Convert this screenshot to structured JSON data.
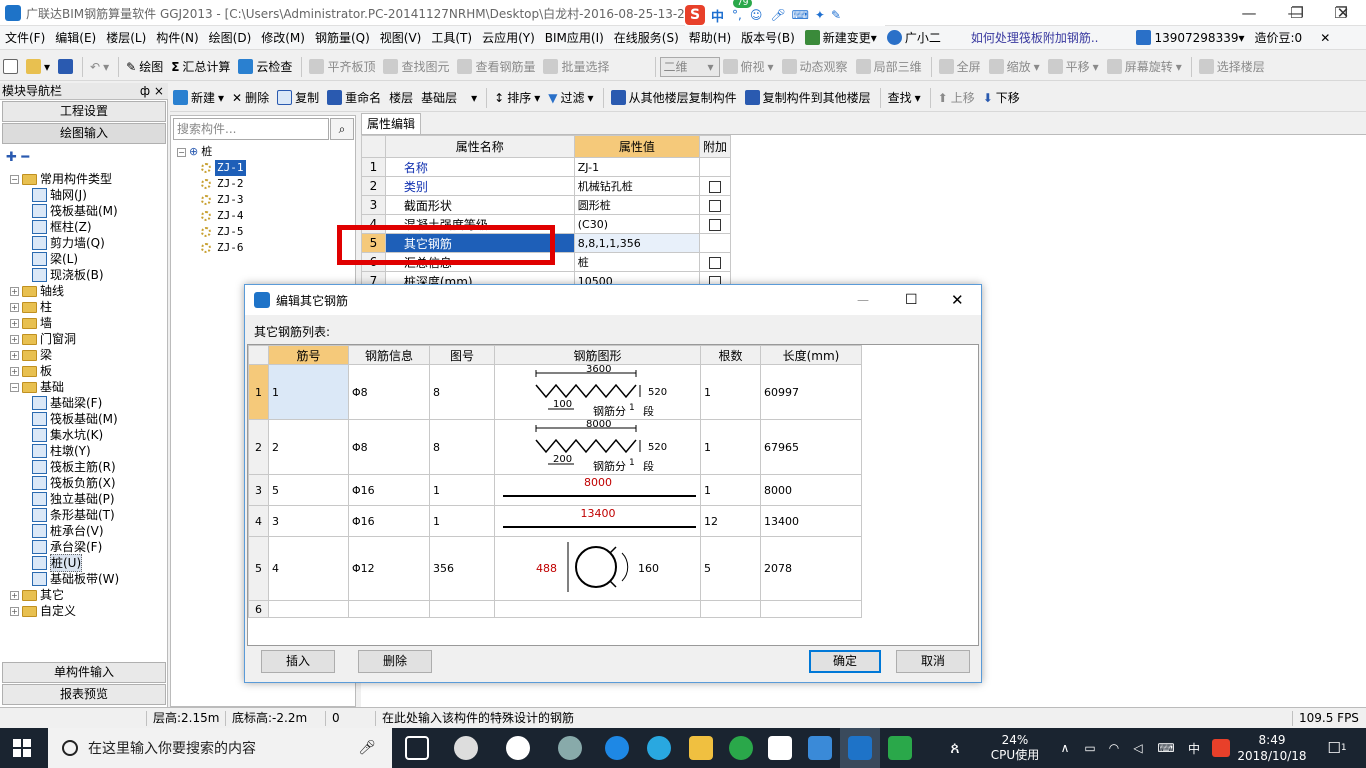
{
  "app": {
    "title": "广联达BIM钢筋算量软件 GGJ2013 - [C:\\Users\\Administrator.PC-20141127NRHM\\Desktop\\白龙村-2016-08-25-13-27",
    "ime_badge": "79",
    "ime_lang": "中"
  },
  "menubar": {
    "items": [
      "文件(F)",
      "编辑(E)",
      "楼层(L)",
      "构件(N)",
      "绘图(D)",
      "修改(M)",
      "钢筋量(Q)",
      "视图(V)",
      "工具(T)",
      "云应用(Y)",
      "BIM应用(I)",
      "在线服务(S)",
      "帮助(H)",
      "版本号(B)",
      "新建变更",
      "广小二"
    ],
    "question_link": "如何处理筏板附加钢筋..",
    "phone": "13907298339",
    "beans": "造价豆:0"
  },
  "toolbar1": {
    "items": [
      "绘图",
      "汇总计算",
      "云检查",
      "平齐板顶",
      "查找图元",
      "查看钢筋量",
      "批量选择"
    ],
    "view_mode": "二维",
    "view_items": [
      "俯视",
      "动态观察",
      "局部三维",
      "全屏",
      "缩放",
      "平移",
      "屏幕旋转",
      "选择楼层"
    ]
  },
  "toolbar2": {
    "items": [
      "新建",
      "删除",
      "复制",
      "重命名",
      "楼层"
    ],
    "floor_value": "基础层",
    "items2": [
      "排序",
      "过滤",
      "从其他楼层复制构件",
      "复制构件到其他楼层",
      "查找",
      "上移",
      "下移"
    ]
  },
  "nav": {
    "header": "模块导航栏",
    "pin": "ф ×",
    "btn_project": "工程设置",
    "btn_draw": "绘图输入",
    "btn_single": "单构件输入",
    "btn_report": "报表预览",
    "tree": [
      {
        "label": "常用构件类型",
        "level": 0,
        "type": "folder",
        "exp": "−"
      },
      {
        "label": "轴网(J)",
        "level": 1,
        "type": "comp"
      },
      {
        "label": "筏板基础(M)",
        "level": 1,
        "type": "comp"
      },
      {
        "label": "框柱(Z)",
        "level": 1,
        "type": "comp"
      },
      {
        "label": "剪力墙(Q)",
        "level": 1,
        "type": "comp"
      },
      {
        "label": "梁(L)",
        "level": 1,
        "type": "comp"
      },
      {
        "label": "现浇板(B)",
        "level": 1,
        "type": "comp"
      },
      {
        "label": "轴线",
        "level": 0,
        "type": "folder",
        "exp": "+"
      },
      {
        "label": "柱",
        "level": 0,
        "type": "folder",
        "exp": "+"
      },
      {
        "label": "墙",
        "level": 0,
        "type": "folder",
        "exp": "+"
      },
      {
        "label": "门窗洞",
        "level": 0,
        "type": "folder",
        "exp": "+"
      },
      {
        "label": "梁",
        "level": 0,
        "type": "folder",
        "exp": "+"
      },
      {
        "label": "板",
        "level": 0,
        "type": "folder",
        "exp": "+"
      },
      {
        "label": "基础",
        "level": 0,
        "type": "folder",
        "exp": "−"
      },
      {
        "label": "基础梁(F)",
        "level": 1,
        "type": "comp"
      },
      {
        "label": "筏板基础(M)",
        "level": 1,
        "type": "comp"
      },
      {
        "label": "集水坑(K)",
        "level": 1,
        "type": "comp"
      },
      {
        "label": "柱墩(Y)",
        "level": 1,
        "type": "comp"
      },
      {
        "label": "筏板主筋(R)",
        "level": 1,
        "type": "comp"
      },
      {
        "label": "筏板负筋(X)",
        "level": 1,
        "type": "comp"
      },
      {
        "label": "独立基础(P)",
        "level": 1,
        "type": "comp"
      },
      {
        "label": "条形基础(T)",
        "level": 1,
        "type": "comp"
      },
      {
        "label": "桩承台(V)",
        "level": 1,
        "type": "comp"
      },
      {
        "label": "承台梁(F)",
        "level": 1,
        "type": "comp"
      },
      {
        "label": "桩(U)",
        "level": 1,
        "type": "comp",
        "selected": true
      },
      {
        "label": "基础板带(W)",
        "level": 1,
        "type": "comp"
      },
      {
        "label": "其它",
        "level": 0,
        "type": "folder",
        "exp": "+"
      },
      {
        "label": "自定义",
        "level": 0,
        "type": "folder",
        "exp": "+"
      }
    ]
  },
  "components": {
    "search_placeholder": "搜索构件...",
    "root": "桩",
    "items": [
      "ZJ-1",
      "ZJ-2",
      "ZJ-3",
      "ZJ-4",
      "ZJ-5",
      "ZJ-6"
    ],
    "selected": "ZJ-1"
  },
  "props": {
    "tab": "属性编辑",
    "headers": [
      "属性名称",
      "属性值",
      "附加"
    ],
    "rows": [
      {
        "n": "1",
        "name": "名称",
        "value": "ZJ-1",
        "blue": true,
        "cb": false
      },
      {
        "n": "2",
        "name": "类别",
        "value": "机械钻孔桩",
        "blue": true,
        "cb": true
      },
      {
        "n": "3",
        "name": "截面形状",
        "value": "圆形桩",
        "blue": false,
        "cb": true
      },
      {
        "n": "4",
        "name": "混凝土强度等级",
        "value": "(C30)",
        "blue": false,
        "cb": true
      },
      {
        "n": "5",
        "name": "其它钢筋",
        "value": "8,8,1,1,356",
        "blue": false,
        "cb": false,
        "selected": true
      },
      {
        "n": "6",
        "name": "汇总信息",
        "value": "桩",
        "blue": false,
        "cb": true
      },
      {
        "n": "7",
        "name": "桩深度(mm)",
        "value": "10500",
        "blue": false,
        "cb": true
      }
    ]
  },
  "dialog": {
    "title": "编辑其它钢筋",
    "list_label": "其它钢筋列表:",
    "headers": [
      "筋号",
      "钢筋信息",
      "图号",
      "钢筋图形",
      "根数",
      "长度(mm)"
    ],
    "rows": [
      {
        "n": "1",
        "bar": "1",
        "info": "Φ8",
        "fig": "8",
        "count": "1",
        "length": "60997",
        "shape": "zigzag",
        "top": "3600",
        "bottom": "100",
        "side": "520",
        "note_a": "钢筋分",
        "note_b": "1",
        "note_c": "段"
      },
      {
        "n": "2",
        "bar": "2",
        "info": "Φ8",
        "fig": "8",
        "count": "1",
        "length": "67965",
        "shape": "zigzag",
        "top": "8000",
        "bottom": "200",
        "side": "520",
        "note_a": "钢筋分",
        "note_b": "1",
        "note_c": "段"
      },
      {
        "n": "3",
        "bar": "5",
        "info": "Φ16",
        "fig": "1",
        "count": "1",
        "length": "8000",
        "shape": "line",
        "dim": "8000"
      },
      {
        "n": "4",
        "bar": "3",
        "info": "Φ16",
        "fig": "1",
        "count": "12",
        "length": "13400",
        "shape": "line",
        "dim": "13400"
      },
      {
        "n": "5",
        "bar": "4",
        "info": "Φ12",
        "fig": "356",
        "count": "5",
        "length": "2078",
        "shape": "ring",
        "dia": "488",
        "hook": "160"
      },
      {
        "n": "6",
        "bar": "",
        "info": "",
        "fig": "",
        "count": "",
        "length": "",
        "shape": "none"
      }
    ],
    "btn_insert": "插入",
    "btn_delete": "删除",
    "btn_ok": "确定",
    "btn_cancel": "取消"
  },
  "status": {
    "floor_height": "层高:2.15m",
    "bottom_height": "底标高:-2.2m",
    "zero": "0",
    "hint": "在此处输入该构件的特殊设计的钢筋",
    "fps": "109.5 FPS"
  },
  "taskbar": {
    "search_placeholder": "在这里输入你要搜索的内容",
    "cpu_percent": "24%",
    "cpu_label": "CPU使用",
    "ime": "中",
    "time": "8:49",
    "date": "2018/10/18",
    "notif_count": "1"
  }
}
